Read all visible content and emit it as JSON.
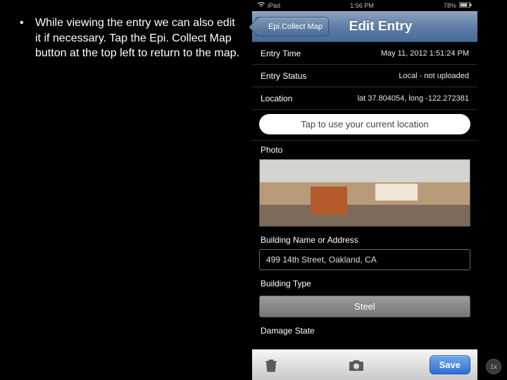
{
  "instruction": {
    "bullet1": "While viewing the entry we can also edit it if necessary. Tap the Epi. Collect Map button at the top left to return to the map."
  },
  "statusbar": {
    "device": "iPad",
    "time": "1:56 PM",
    "battery": "78%"
  },
  "nav": {
    "back_label": "Epi.Collect Map",
    "title": "Edit Entry"
  },
  "entry": {
    "time_label": "Entry Time",
    "time_value": "May 11, 2012 1:51:24 PM",
    "status_label": "Entry Status",
    "status_value": "Local - not uploaded",
    "location_label": "Location",
    "location_value": "lat 37.804054, long -122.272381",
    "location_action": "Tap to use your current location",
    "photo_label": "Photo",
    "building_name_label": "Building Name or Address",
    "building_name_value": "499 14th Street, Oakland, CA",
    "building_type_label": "Building Type",
    "building_type_value": "Steel",
    "damage_label": "Damage State"
  },
  "toolbar": {
    "save_label": "Save"
  },
  "corner": {
    "onex": "1x"
  }
}
